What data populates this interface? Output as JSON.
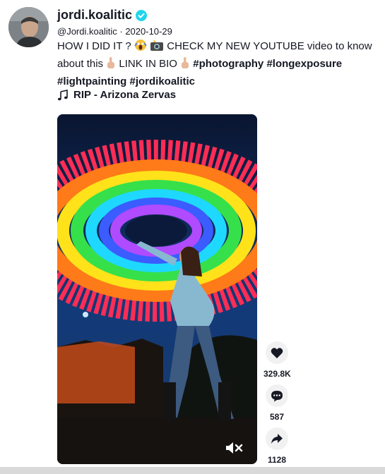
{
  "post": {
    "username": "jordi.koalitic",
    "handle": "@Jordi.koalitic",
    "separator": "·",
    "date": "2020-10-29",
    "caption": {
      "line1_a": "HOW I DID IT ?",
      "line1_b": "CHECK MY NEW YOUTUBE video to know about this",
      "link_in_bio": "LINK IN BIO",
      "hashtags": [
        "#photography",
        "#longexposure",
        "#lightpainting",
        "#jordikoalitic"
      ]
    },
    "music": "RIP - Arizona Zervas"
  },
  "icons": {
    "verified": "verified-badge-icon",
    "music": "music-note-icon",
    "like": "heart-icon",
    "comment": "comment-icon",
    "share": "share-icon",
    "mute": "mute-icon"
  },
  "actions": {
    "likes": "329.8K",
    "comments": "587",
    "shares": "1128"
  },
  "colors": {
    "verified": "#20D5EC",
    "text": "#161823",
    "action_bg": "#F1F1F2"
  }
}
